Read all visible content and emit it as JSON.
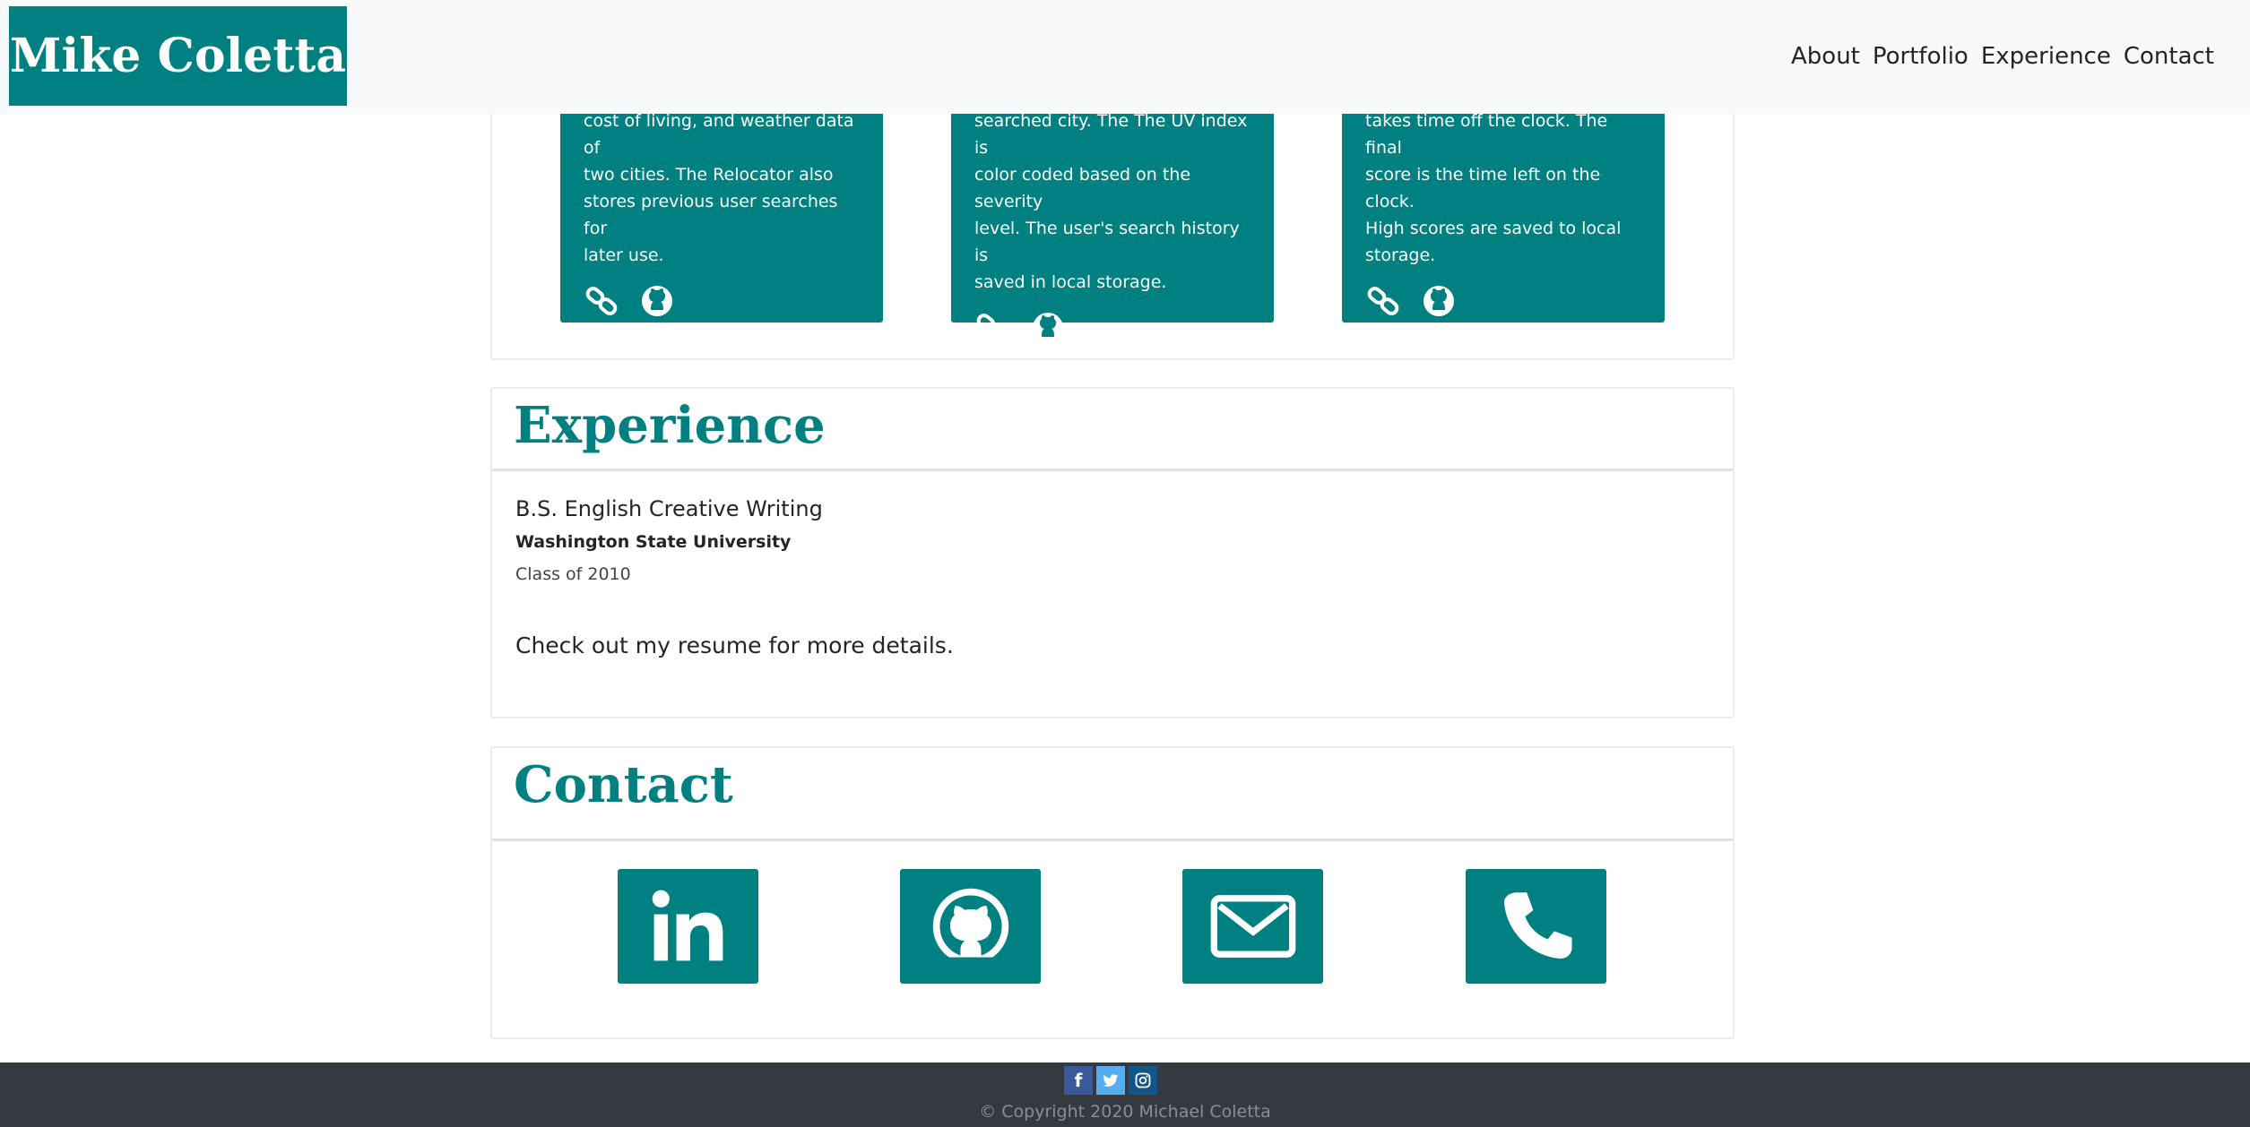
{
  "navbar": {
    "brand": "Mike Coletta",
    "links": [
      "About",
      "Portfolio",
      "Experience",
      "Contact"
    ]
  },
  "portfolio": {
    "projects": [
      {
        "lines": [
          "cost of living, and weather data of",
          "two cities. The Relocator also",
          "stores previous user searches for",
          "later use."
        ],
        "link_icon": "link-icon",
        "github_icon": "github-icon"
      },
      {
        "lines": [
          "searched city. The The UV index is",
          "color coded based on the severity",
          "level. The user's search history is",
          "saved in local storage."
        ],
        "link_icon": "link-icon",
        "github_icon": "github-icon"
      },
      {
        "lines": [
          "takes time off the clock. The final",
          "score is the time left on the clock.",
          "High scores are saved to local",
          "storage."
        ],
        "link_icon": "link-icon",
        "github_icon": "github-icon"
      }
    ]
  },
  "experience": {
    "title": "Experience",
    "degree": "B.S. English Creative Writing",
    "school": "Washington State University",
    "class_of": "Class of 2010",
    "resume_pre": "Check out my ",
    "resume_link": "resume",
    "resume_post": " for more details."
  },
  "contact": {
    "title": "Contact",
    "buttons": [
      "linkedin-icon",
      "github-icon",
      "envelope-icon",
      "phone-icon"
    ]
  },
  "footer": {
    "social": [
      "facebook-icon",
      "twitter-icon",
      "instagram-icon"
    ],
    "social_colors": [
      "#3b5998",
      "#55acee",
      "#125688"
    ],
    "copyright": "© Copyright 2020 Michael Coletta"
  },
  "colors": {
    "accent": "#008080",
    "navbar_bg": "#f8f9fa",
    "footer_bg": "#343a40"
  }
}
